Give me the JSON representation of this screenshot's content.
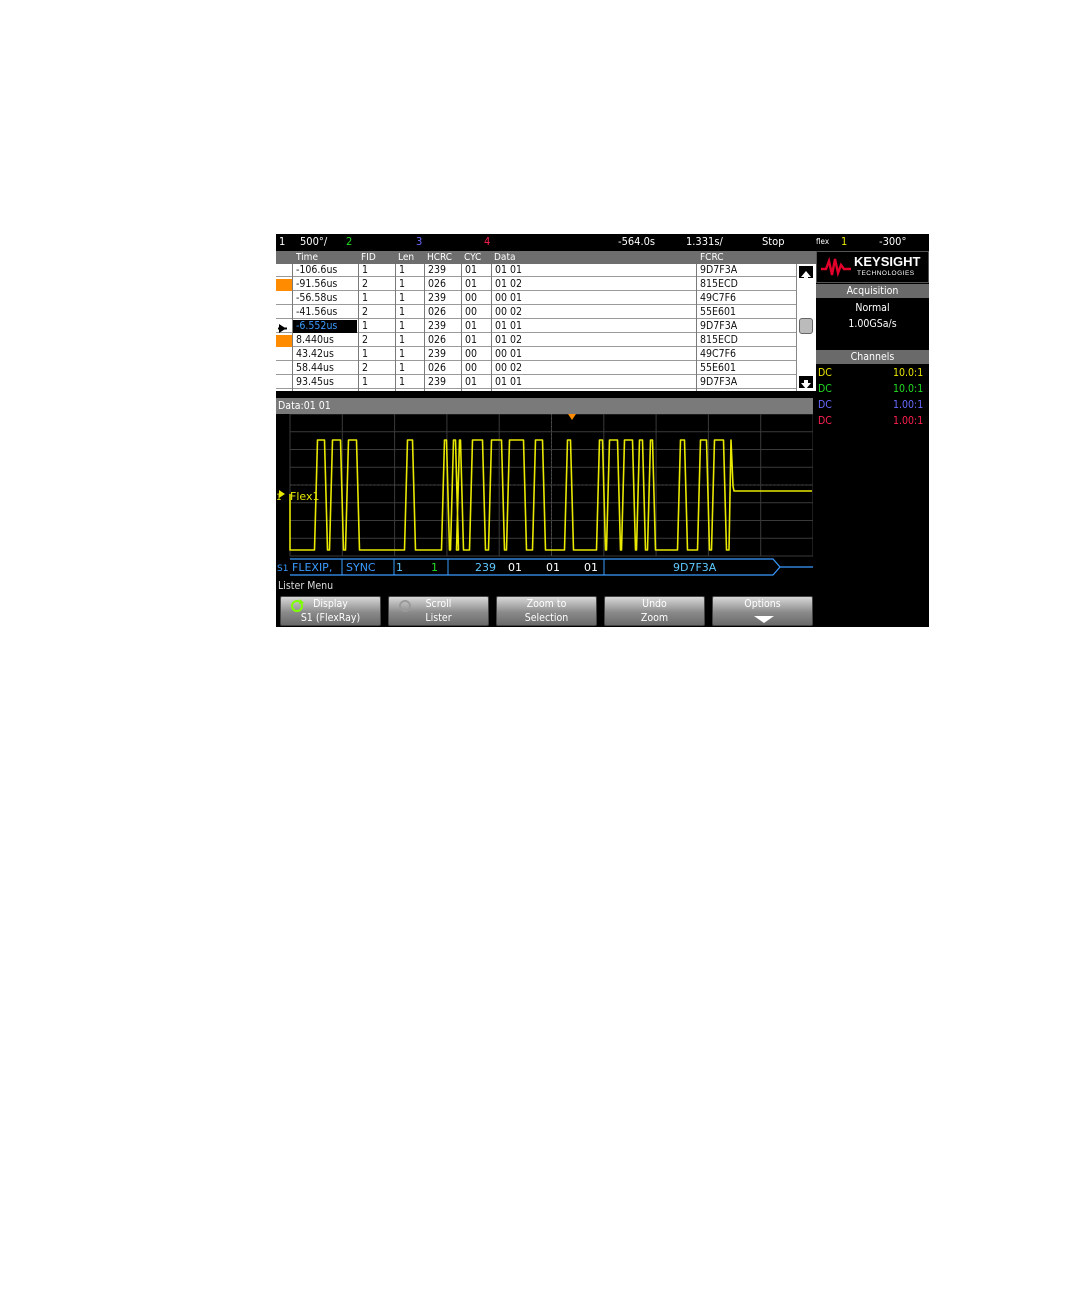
{
  "topbar": {
    "ch1_num": "1",
    "ch1_scale": "500°/",
    "ch2_num": "2",
    "ch3_num": "3",
    "ch4_num": "4",
    "time_position": "-564.0s",
    "time_scale": "1.331s/",
    "run_state": "Stop",
    "trigger_label": "flex",
    "trigger_src": "1",
    "trigger_level": "-300°"
  },
  "lister": {
    "columns": [
      "Time",
      "FID",
      "Len",
      "HCRC",
      "CYC",
      "Data",
      "FCRC"
    ],
    "rows": [
      {
        "time": "-106.6us",
        "fid": "1",
        "len": "1",
        "hcrc": "239",
        "cyc": "01",
        "data": "01  01",
        "fcrc": "9D7F3A",
        "marker": ""
      },
      {
        "time": "-91.56us",
        "fid": "2",
        "len": "1",
        "hcrc": "026",
        "cyc": "01",
        "data": "01  02",
        "fcrc": "815ECD",
        "marker": "orange"
      },
      {
        "time": "-56.58us",
        "fid": "1",
        "len": "1",
        "hcrc": "239",
        "cyc": "00",
        "data": "00  01",
        "fcrc": "49C7F6",
        "marker": ""
      },
      {
        "time": "-41.56us",
        "fid": "2",
        "len": "1",
        "hcrc": "026",
        "cyc": "00",
        "data": "00  02",
        "fcrc": "55E601",
        "marker": ""
      },
      {
        "time": "-6.552us",
        "fid": "1",
        "len": "1",
        "hcrc": "239",
        "cyc": "01",
        "data": "01  01",
        "fcrc": "9D7F3A",
        "marker": "arrow"
      },
      {
        "time": "8.440us",
        "fid": "2",
        "len": "1",
        "hcrc": "026",
        "cyc": "01",
        "data": "01  02",
        "fcrc": "815ECD",
        "marker": "orange"
      },
      {
        "time": "43.42us",
        "fid": "1",
        "len": "1",
        "hcrc": "239",
        "cyc": "00",
        "data": "00  01",
        "fcrc": "49C7F6",
        "marker": ""
      },
      {
        "time": "58.44us",
        "fid": "2",
        "len": "1",
        "hcrc": "026",
        "cyc": "00",
        "data": "00  02",
        "fcrc": "55E601",
        "marker": ""
      },
      {
        "time": "93.45us",
        "fid": "1",
        "len": "1",
        "hcrc": "239",
        "cyc": "01",
        "data": "01  01",
        "fcrc": "9D7F3A",
        "marker": ""
      }
    ]
  },
  "selection": {
    "data_label": "Data:01  01"
  },
  "waveform": {
    "channel_label": "Flex1",
    "channel_marker": "1",
    "decode": {
      "bus_marker": "S1",
      "protocol": "FLEXIP,",
      "sync": "SYNC",
      "fid": "1",
      "len": "1",
      "hcrc": "239",
      "cyc": "01",
      "data1": "01",
      "data2": "01",
      "fcrc": "9D7F3A"
    }
  },
  "menu": {
    "title": "Lister Menu",
    "softkeys": [
      {
        "line1": "Display",
        "line2": "S1 (FlexRay)"
      },
      {
        "line1": "Scroll",
        "line2": "Lister"
      },
      {
        "line1": "Zoom to",
        "line2": "Selection"
      },
      {
        "line1": "Undo",
        "line2": "Zoom"
      },
      {
        "line1": "Options",
        "line2": ""
      }
    ]
  },
  "right_panel": {
    "brand": "KEYSIGHT",
    "brand_sub": "TECHNOLOGIES",
    "acquisition_title": "Acquisition",
    "acq_mode": "Normal",
    "acq_rate": "1.00GSa/s",
    "channels_title": "Channels",
    "channels": [
      {
        "coupling": "DC",
        "ratio": "10.0:1",
        "color": "#e8e800"
      },
      {
        "coupling": "DC",
        "ratio": "10.0:1",
        "color": "#22dd22"
      },
      {
        "coupling": "DC",
        "ratio": "1.00:1",
        "color": "#6a6aff"
      },
      {
        "coupling": "DC",
        "ratio": "1.00:1",
        "color": "#ff2050"
      }
    ]
  },
  "colors": {
    "ch1": "#e8e800",
    "ch2": "#22dd22",
    "ch3": "#6a6aff",
    "ch4": "#ff2050",
    "decode": "#3a9bff",
    "marker": "#ff8c00",
    "brand_red": "#e3002b"
  }
}
